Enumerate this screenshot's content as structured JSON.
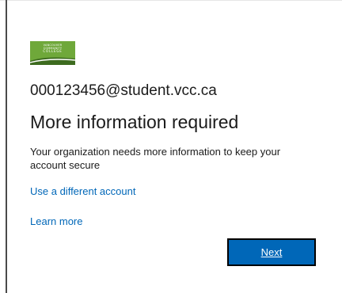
{
  "logo": {
    "line1": "VANCOUVER",
    "line2": "COMMUNITY",
    "line3": "COLLEGE",
    "color": "#6fa83a"
  },
  "account_email": "000123456@student.vcc.ca",
  "heading": "More information required",
  "description": "Your organization needs more information to keep your account secure",
  "links": {
    "use_different_account": "Use a different account",
    "learn_more": "Learn more"
  },
  "buttons": {
    "next": "Next"
  },
  "colors": {
    "link": "#0067b8",
    "button_bg": "#0067b8",
    "button_border": "#000000"
  }
}
